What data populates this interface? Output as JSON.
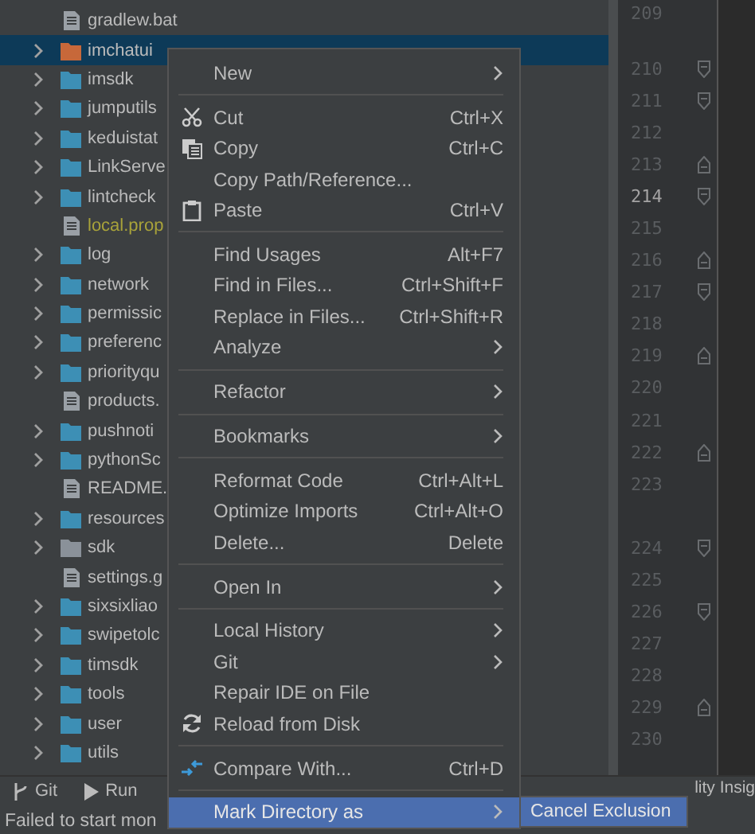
{
  "project_tree": [
    {
      "kind": "file",
      "label": "gradlew.bat",
      "selected": false
    },
    {
      "kind": "folder",
      "label": "imchatui",
      "color": "#c7683a",
      "selected": true
    },
    {
      "kind": "folder",
      "label": "imsdk",
      "color": "#3d8fb5",
      "selected": false
    },
    {
      "kind": "folder",
      "label": "jumputils",
      "color": "#3d8fb5",
      "selected": false
    },
    {
      "kind": "folder",
      "label": "keduistat",
      "color": "#3d8fb5",
      "selected": false
    },
    {
      "kind": "folder",
      "label": "LinkServe",
      "color": "#3d8fb5",
      "selected": false
    },
    {
      "kind": "folder",
      "label": "lintcheck",
      "color": "#3d8fb5",
      "selected": false
    },
    {
      "kind": "file",
      "label": "local.prop",
      "ignored": true,
      "selected": false
    },
    {
      "kind": "folder",
      "label": "log",
      "color": "#3d8fb5",
      "selected": false
    },
    {
      "kind": "folder",
      "label": "network",
      "color": "#3d8fb5",
      "selected": false
    },
    {
      "kind": "folder",
      "label": "permissic",
      "color": "#3d8fb5",
      "selected": false
    },
    {
      "kind": "folder",
      "label": "preferenc",
      "color": "#3d8fb5",
      "selected": false
    },
    {
      "kind": "folder",
      "label": "priorityqu",
      "color": "#3d8fb5",
      "selected": false
    },
    {
      "kind": "file",
      "label": "products.",
      "selected": false
    },
    {
      "kind": "folder",
      "label": "pushnoti",
      "color": "#3d8fb5",
      "selected": false
    },
    {
      "kind": "folder",
      "label": "pythonSc",
      "color": "#3d8fb5",
      "selected": false
    },
    {
      "kind": "file",
      "label": "README.",
      "selected": false
    },
    {
      "kind": "folder",
      "label": "resources",
      "color": "#3d8fb5",
      "selected": false
    },
    {
      "kind": "folder",
      "label": "sdk",
      "color": "#8a9199",
      "selected": false
    },
    {
      "kind": "file",
      "label": "settings.g",
      "selected": false
    },
    {
      "kind": "folder",
      "label": "sixsixliao",
      "color": "#3d8fb5",
      "selected": false
    },
    {
      "kind": "folder",
      "label": "swipetolc",
      "color": "#3d8fb5",
      "selected": false
    },
    {
      "kind": "folder",
      "label": "timsdk",
      "color": "#3d8fb5",
      "selected": false
    },
    {
      "kind": "folder",
      "label": "tools",
      "color": "#3d8fb5",
      "selected": false
    },
    {
      "kind": "folder",
      "label": "user",
      "color": "#3d8fb5",
      "selected": false
    },
    {
      "kind": "folder",
      "label": "utils",
      "color": "#3d8fb5",
      "selected": false
    }
  ],
  "gutter": [
    {
      "number": "209",
      "kind": "plain",
      "current": false
    },
    {
      "kind": "inlay"
    },
    {
      "number": "210",
      "kind": "foldstart",
      "current": false
    },
    {
      "number": "211",
      "kind": "foldstart",
      "current": false
    },
    {
      "number": "212",
      "kind": "plain",
      "current": false
    },
    {
      "number": "213",
      "kind": "foldend",
      "current": false
    },
    {
      "number": "214",
      "kind": "foldstart",
      "current": true
    },
    {
      "number": "215",
      "kind": "plain",
      "current": false
    },
    {
      "number": "216",
      "kind": "foldend",
      "current": false
    },
    {
      "number": "217",
      "kind": "foldstart",
      "current": false
    },
    {
      "number": "218",
      "kind": "plain",
      "current": false
    },
    {
      "number": "219",
      "kind": "foldend",
      "current": false
    },
    {
      "number": "220",
      "kind": "plain",
      "current": false
    },
    {
      "number": "221",
      "kind": "plain",
      "current": false
    },
    {
      "number": "222",
      "kind": "foldend",
      "current": false
    },
    {
      "number": "223",
      "kind": "plain",
      "current": false
    },
    {
      "kind": "inlay"
    },
    {
      "number": "224",
      "kind": "foldstart",
      "current": false
    },
    {
      "number": "225",
      "kind": "plain",
      "current": false
    },
    {
      "number": "226",
      "kind": "foldstart",
      "current": false
    },
    {
      "number": "227",
      "kind": "plain",
      "current": false
    },
    {
      "number": "228",
      "kind": "plain",
      "current": false
    },
    {
      "number": "229",
      "kind": "foldend",
      "current": false
    },
    {
      "number": "230",
      "kind": "plain",
      "current": false
    }
  ],
  "context_menu": [
    {
      "kind": "item",
      "label": "New",
      "submenu": true,
      "selected": false
    },
    {
      "kind": "separator"
    },
    {
      "kind": "scissors",
      "label": "Cut",
      "shortcut": "Ctrl+X",
      "selected": false
    },
    {
      "kind": "copy",
      "label": "Copy",
      "shortcut": "Ctrl+C",
      "selected": false
    },
    {
      "kind": "item",
      "label": "Copy Path/Reference...",
      "selected": false
    },
    {
      "kind": "clipboard",
      "label": "Paste",
      "shortcut": "Ctrl+V",
      "selected": false
    },
    {
      "kind": "separator"
    },
    {
      "kind": "item",
      "label": "Find Usages",
      "shortcut": "Alt+F7",
      "selected": false
    },
    {
      "kind": "item",
      "label": "Find in Files...",
      "shortcut": "Ctrl+Shift+F",
      "selected": false
    },
    {
      "kind": "item",
      "label": "Replace in Files...",
      "shortcut": "Ctrl+Shift+R",
      "selected": false
    },
    {
      "kind": "item",
      "label": "Analyze",
      "submenu": true,
      "selected": false
    },
    {
      "kind": "separator"
    },
    {
      "kind": "item",
      "label": "Refactor",
      "submenu": true,
      "selected": false
    },
    {
      "kind": "separator"
    },
    {
      "kind": "item",
      "label": "Bookmarks",
      "submenu": true,
      "selected": false
    },
    {
      "kind": "separator"
    },
    {
      "kind": "item",
      "label": "Reformat Code",
      "shortcut": "Ctrl+Alt+L",
      "selected": false
    },
    {
      "kind": "item",
      "label": "Optimize Imports",
      "shortcut": "Ctrl+Alt+O",
      "selected": false
    },
    {
      "kind": "item",
      "label": "Delete...",
      "shortcut": "Delete",
      "selected": false
    },
    {
      "kind": "separator"
    },
    {
      "kind": "item",
      "label": "Open In",
      "submenu": true,
      "selected": false
    },
    {
      "kind": "separator"
    },
    {
      "kind": "item",
      "label": "Local History",
      "submenu": true,
      "selected": false
    },
    {
      "kind": "item",
      "label": "Git",
      "submenu": true,
      "selected": false
    },
    {
      "kind": "item",
      "label": "Repair IDE on File",
      "selected": false
    },
    {
      "kind": "reload",
      "label": "Reload from Disk",
      "selected": false
    },
    {
      "kind": "separator"
    },
    {
      "kind": "compare",
      "label": "Compare With...",
      "shortcut": "Ctrl+D",
      "selected": false
    },
    {
      "kind": "separator"
    },
    {
      "kind": "item",
      "label": "Mark Directory as",
      "submenu": true,
      "selected": true
    }
  ],
  "submenu": [
    {
      "label": "Cancel Exclusion",
      "selected": true
    }
  ],
  "tool_window_bar": [
    {
      "label": "Git",
      "kind": "branch"
    },
    {
      "label": "Run",
      "kind": "play"
    },
    {
      "label": "lity Insig",
      "kind": "text"
    }
  ],
  "status_bar": {
    "message": "Failed to start mon"
  }
}
